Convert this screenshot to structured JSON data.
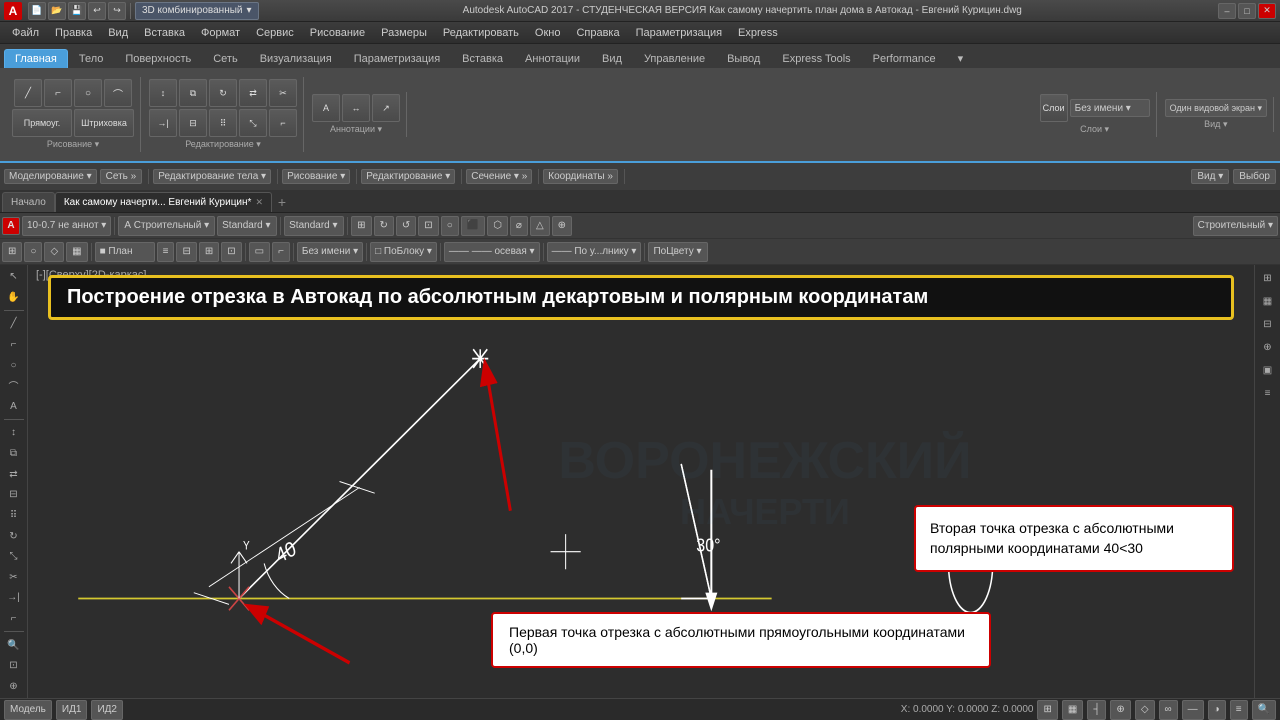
{
  "titlebar": {
    "app_name": "A",
    "title": "Autodesk AutoCAD 2017 - СТУДЕНЧЕСКАЯ ВЕРСИЯ    Как самому начертить план дома в Автокад - Евгений Курицин.dwg",
    "min": "–",
    "max": "□",
    "close": "✕"
  },
  "quickaccess": {
    "dropdown_label": "3D комбинированный",
    "buttons": [
      "💾",
      "↩",
      "↪",
      "📋",
      "✂",
      "📄"
    ]
  },
  "menubar": {
    "items": [
      "Файл",
      "Правка",
      "Вид",
      "Вставка",
      "Формат",
      "Сервис",
      "Рисование",
      "Размеры",
      "Редактировать",
      "Окно",
      "Справка",
      "Параметризация",
      "Express"
    ]
  },
  "ribbon": {
    "tabs": [
      {
        "label": "Главная",
        "active": true
      },
      {
        "label": "Тело",
        "active": false
      },
      {
        "label": "Поверхность",
        "active": false
      },
      {
        "label": "Сеть",
        "active": false
      },
      {
        "label": "Визуализация",
        "active": false
      },
      {
        "label": "Параметризация",
        "active": false
      },
      {
        "label": "Вставка",
        "active": false
      },
      {
        "label": "Аннотации",
        "active": false
      },
      {
        "label": "Вид",
        "active": false
      },
      {
        "label": "Управление",
        "active": false
      },
      {
        "label": "Вывод",
        "active": false
      },
      {
        "label": "Express Tools",
        "active": false
      },
      {
        "label": "Performance",
        "active": false
      }
    ]
  },
  "toolbar_row2": {
    "modelling": "Моделирование ▾",
    "net": "Сеть »",
    "body_edit": "Редактирование тела ▾",
    "drawing": "Рисование ▾",
    "editing": "Редактирование ▾",
    "section": "Сечение ▾ »",
    "coordinates": "Координаты »",
    "view": "Вид ▾",
    "selection": "Выбор"
  },
  "doc_tabs": {
    "tab1": "Начало",
    "tab2": "Как самому начерти... Евгений Курицин*",
    "new": "+"
  },
  "toolbar3": {
    "dropdown1": "10-0.7 не аннот ▾",
    "dropdown2": "А Строительный ▾",
    "dropdown3": "Standard ▾",
    "dropdown4": "Standard ▾",
    "icon_buttons": 20
  },
  "toolbar4": {
    "dropdown1": "■ План",
    "dropdown2": "Без имени ▾",
    "dropdown3": "□ ПоБлоку ▾",
    "dropdown4": "—— —— осевая ▾",
    "dropdown5": "—— По у...лнику ▾",
    "dropdown6": "ПоЦвету ▾"
  },
  "viewport_label": "[-][Сверху][2D-каркас]",
  "canvas": {
    "bg_color": "#2d2d2d",
    "drawing_color": "white"
  },
  "banner_top": {
    "text": "Построение отрезка в Автокад по абсолютным декартовым и полярным координатам"
  },
  "annotation1": {
    "text": "Вторая точка отрезка с абсолютными полярными координатами 40<30"
  },
  "annotation2": {
    "text": "Первая точка отрезка с абсолютными прямоугольными координатами (0,0)"
  },
  "dimensions": {
    "dim1": "40",
    "dim2": "30°"
  },
  "statusbar": {
    "model": "Модель",
    "layout1": "ИД1",
    "layout2": "ИД2",
    "coords": "X: 0.0000  Y: 0.0000  Z: 0.0000"
  }
}
